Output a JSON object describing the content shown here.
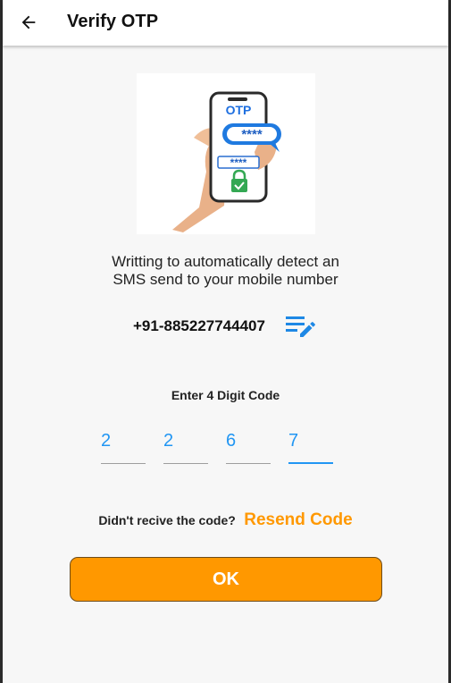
{
  "header": {
    "title": "Verify OTP",
    "back_icon": "arrow-back-icon"
  },
  "illustration": {
    "otp_label": "OTP",
    "bubble_mask": "****",
    "field_mask": "****",
    "icon": "smartphone-otp-lock-icon"
  },
  "detect_message": {
    "line1": "Writting to automatically detect an",
    "line2": "SMS send to your mobile number"
  },
  "phone": {
    "number": "+91-885227744407",
    "edit_icon": "edit-note-icon"
  },
  "code_entry": {
    "label": "Enter 4 Digit Code",
    "digits": [
      "2",
      "2",
      "6",
      "7"
    ],
    "focused_index": 3
  },
  "resend": {
    "question": "Didn't recive the code?",
    "link": "Resend Code"
  },
  "ok_button": {
    "label": "OK"
  },
  "colors": {
    "accent": "#ff9800",
    "digit_blue": "#2196f3",
    "edit_blue": "#1e88e5",
    "background": "#f7f7f7"
  }
}
